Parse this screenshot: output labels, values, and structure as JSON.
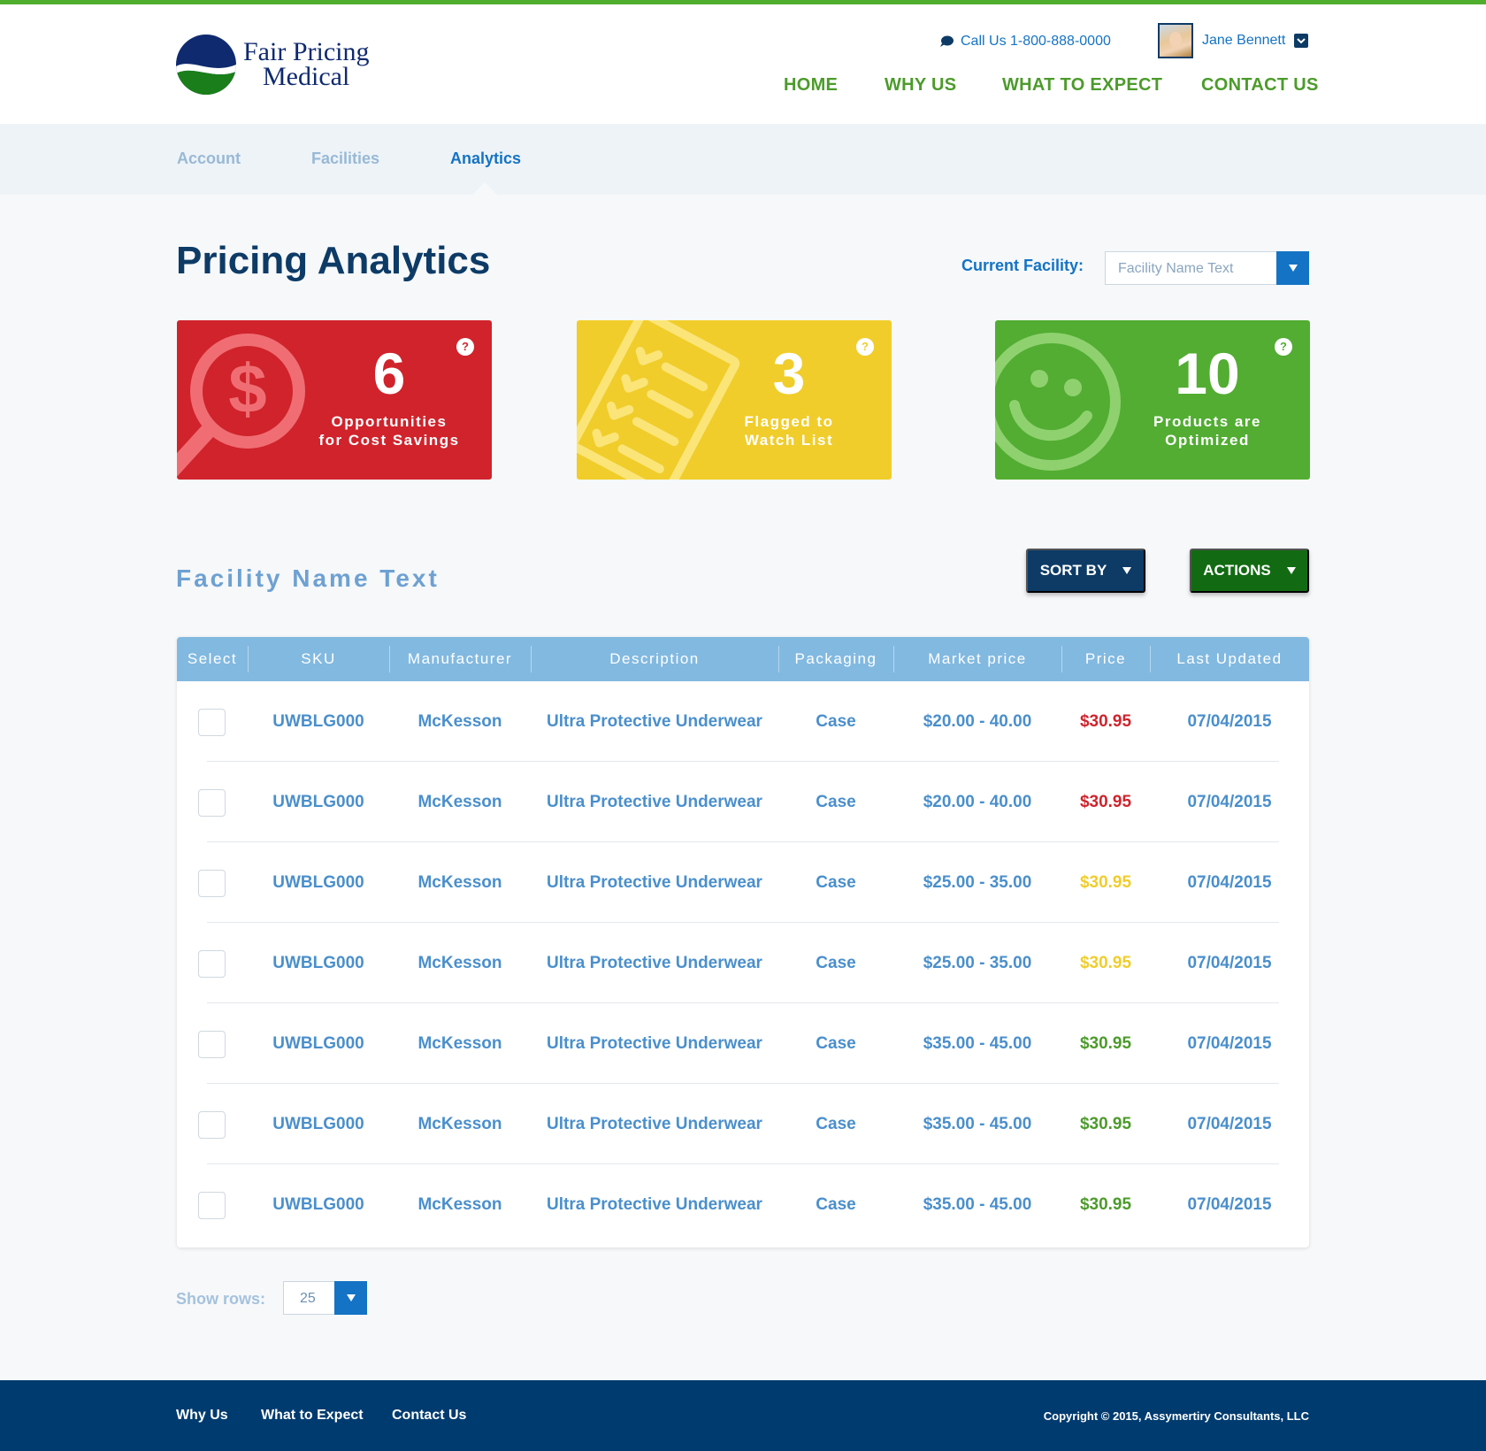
{
  "brand": {
    "name_line1": "Fair Pricing",
    "name_line2": "Medical",
    "colors": {
      "navy": "#0d3b66",
      "green": "#4c9b2b",
      "blue": "#1473c4",
      "red": "#d0232c",
      "yellow": "#f0cd2b"
    }
  },
  "header": {
    "call_us": "Call Us 1-800-888-0000",
    "user_name": "Jane Bennett",
    "nav": [
      "HOME",
      "WHY US",
      "WHAT TO EXPECT",
      "CONTACT US"
    ]
  },
  "subnav": {
    "items": [
      {
        "label": "Account",
        "active": false
      },
      {
        "label": "Facilities",
        "active": false
      },
      {
        "label": "Analytics",
        "active": true
      }
    ]
  },
  "page": {
    "title": "Pricing Analytics",
    "current_facility_label": "Current Facility:",
    "current_facility_value": "Facility Name Text"
  },
  "cards": [
    {
      "number": "6",
      "line1": "Opportunities",
      "line2": "for Cost Savings",
      "help": "?",
      "icon": "magnifier-dollar-icon",
      "color": "#d0232c"
    },
    {
      "number": "3",
      "line1": "Flagged to",
      "line2": "Watch List",
      "help": "?",
      "icon": "checklist-icon",
      "color": "#f0cd2b"
    },
    {
      "number": "10",
      "line1": "Products are",
      "line2": "Optimized",
      "help": "?",
      "icon": "smiley-icon",
      "color": "#52ad32"
    }
  ],
  "section": {
    "title": "Facility Name Text",
    "sort_label": "SORT BY",
    "actions_label": "ACTIONS"
  },
  "table": {
    "columns": [
      "Select",
      "SKU",
      "Manufacturer",
      "Description",
      "Packaging",
      "Market price",
      "Price",
      "Last Updated"
    ],
    "rows": [
      {
        "sku": "UWBLG000",
        "manufacturer": "McKesson",
        "description": "Ultra Protective Underwear",
        "packaging": "Case",
        "market_price": "$20.00 - 40.00",
        "price": "$30.95",
        "price_status": "red",
        "last_updated": "07/04/2015"
      },
      {
        "sku": "UWBLG000",
        "manufacturer": "McKesson",
        "description": "Ultra Protective Underwear",
        "packaging": "Case",
        "market_price": "$20.00 - 40.00",
        "price": "$30.95",
        "price_status": "red",
        "last_updated": "07/04/2015"
      },
      {
        "sku": "UWBLG000",
        "manufacturer": "McKesson",
        "description": "Ultra Protective Underwear",
        "packaging": "Case",
        "market_price": "$25.00 - 35.00",
        "price": "$30.95",
        "price_status": "yellow",
        "last_updated": "07/04/2015"
      },
      {
        "sku": "UWBLG000",
        "manufacturer": "McKesson",
        "description": "Ultra Protective Underwear",
        "packaging": "Case",
        "market_price": "$25.00 - 35.00",
        "price": "$30.95",
        "price_status": "yellow",
        "last_updated": "07/04/2015"
      },
      {
        "sku": "UWBLG000",
        "manufacturer": "McKesson",
        "description": "Ultra Protective Underwear",
        "packaging": "Case",
        "market_price": "$35.00 - 45.00",
        "price": "$30.95",
        "price_status": "green",
        "last_updated": "07/04/2015"
      },
      {
        "sku": "UWBLG000",
        "manufacturer": "McKesson",
        "description": "Ultra Protective Underwear",
        "packaging": "Case",
        "market_price": "$35.00 - 45.00",
        "price": "$30.95",
        "price_status": "green",
        "last_updated": "07/04/2015"
      },
      {
        "sku": "UWBLG000",
        "manufacturer": "McKesson",
        "description": "Ultra Protective Underwear",
        "packaging": "Case",
        "market_price": "$35.00 - 45.00",
        "price": "$30.95",
        "price_status": "green",
        "last_updated": "07/04/2015"
      }
    ],
    "price_colors": {
      "red": "#d0232c",
      "yellow": "#f0cd2b",
      "green": "#4c9b2b"
    }
  },
  "pagination": {
    "show_rows_label": "Show rows:",
    "show_rows_value": "25"
  },
  "footer": {
    "links": [
      "Why Us",
      "What to Expect",
      "Contact Us"
    ],
    "copyright": "Copyright © 2015, Assymertiry Consultants, LLC"
  }
}
